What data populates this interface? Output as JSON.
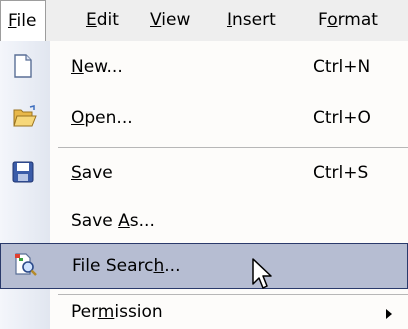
{
  "menubar": {
    "items": [
      {
        "pre": "",
        "ul": "F",
        "post": "ile"
      },
      {
        "pre": "",
        "ul": "E",
        "post": "dit"
      },
      {
        "pre": "",
        "ul": "V",
        "post": "iew"
      },
      {
        "pre": "",
        "ul": "I",
        "post": "nsert"
      },
      {
        "pre": "F",
        "ul": "o",
        "post": "rmat"
      }
    ]
  },
  "file_menu": {
    "items": [
      {
        "pre": "",
        "ul": "N",
        "post": "ew...",
        "shortcut": "Ctrl+N",
        "icon": "new-document-icon"
      },
      {
        "pre": "",
        "ul": "O",
        "post": "pen...",
        "shortcut": "Ctrl+O",
        "icon": "open-folder-icon"
      },
      {
        "pre": "",
        "ul": "S",
        "post": "ave",
        "shortcut": "Ctrl+S",
        "icon": "save-disk-icon"
      },
      {
        "pre": "Save ",
        "ul": "A",
        "post": "s...",
        "shortcut": ""
      },
      {
        "pre": "File Searc",
        "ul": "h",
        "post": "...",
        "shortcut": "",
        "icon": "file-search-icon"
      },
      {
        "pre": "Per",
        "ul": "m",
        "post": "ission",
        "shortcut": "",
        "submenu": true
      }
    ]
  },
  "colors": {
    "highlight_bg": "#b6bdd2",
    "highlight_border": "#2a3a6b",
    "menubar_bg": "#eeeeee"
  }
}
